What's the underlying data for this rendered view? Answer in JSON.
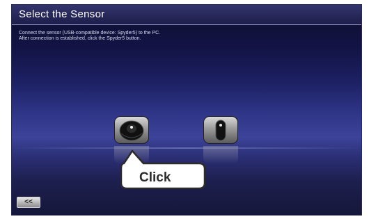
{
  "window": {
    "title": "Select the Sensor",
    "instructions": "Connect the sensor (USB-compatible device: Spyder5) to the PC.\nAfter connection is established, click the Spyder5 button."
  },
  "sensors": [
    {
      "name": "spyder5-sensor",
      "icon": "puck-sensor-icon"
    },
    {
      "name": "other-sensor",
      "icon": "oblong-sensor-icon"
    }
  ],
  "callout": {
    "label": "Click"
  },
  "navigation": {
    "back_label": "<<"
  },
  "colors": {
    "title_text": "#ffffff",
    "background_top": "#0d0e2c",
    "background_mid": "#3c4399",
    "callout_border": "#2b2b2b"
  }
}
